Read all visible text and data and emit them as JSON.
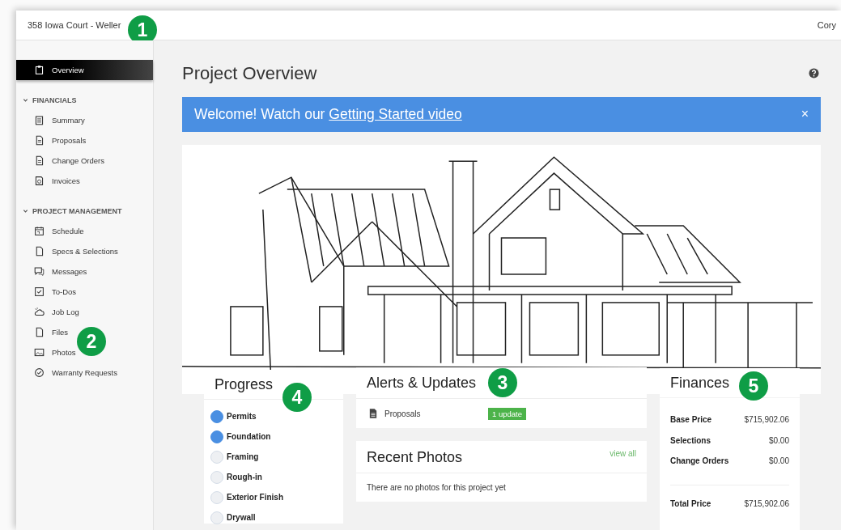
{
  "topbar": {
    "project": "358 Iowa Court - Weller",
    "user": "Cory"
  },
  "sidebar": {
    "items": [
      {
        "label": "Overview",
        "selected": true
      }
    ],
    "sections": [
      {
        "title": "FINANCIALS",
        "expanded": true,
        "items": [
          {
            "label": "Summary",
            "selected": false
          },
          {
            "label": "Proposals",
            "selected": false
          },
          {
            "label": "Change Orders",
            "selected": false
          },
          {
            "label": "Invoices",
            "selected": false
          }
        ]
      },
      {
        "title": "PROJECT MANAGEMENT",
        "expanded": true,
        "items": [
          {
            "label": "Schedule",
            "selected": false
          },
          {
            "label": "Specs & Selections",
            "selected": false
          },
          {
            "label": "Messages",
            "selected": false
          },
          {
            "label": "To-Dos",
            "selected": false
          },
          {
            "label": "Job Log",
            "selected": false
          },
          {
            "label": "Files",
            "selected": false
          },
          {
            "label": "Photos",
            "selected": false
          },
          {
            "label": "Warranty Requests",
            "selected": false
          }
        ]
      }
    ]
  },
  "page": {
    "title": "Project Overview"
  },
  "banner": {
    "text": "Welcome! Watch our",
    "link": "Getting Started video",
    "close": "×"
  },
  "progress": {
    "title": "Progress",
    "steps": [
      {
        "label": "Permits",
        "done": true
      },
      {
        "label": "Foundation",
        "done": true
      },
      {
        "label": "Framing",
        "done": false
      },
      {
        "label": "Rough-in",
        "done": false
      },
      {
        "label": "Exterior Finish",
        "done": false
      },
      {
        "label": "Drywall",
        "done": false
      }
    ]
  },
  "alerts": {
    "title": "Alerts & Updates",
    "items": [
      {
        "label": "Proposals",
        "badge": "1 update"
      }
    ]
  },
  "recent_photos": {
    "title": "Recent Photos",
    "link": "view all",
    "empty": "There are no photos for this project yet"
  },
  "finances": {
    "title": "Finances",
    "rows": [
      {
        "label": "Base Price",
        "value": "$715,902.06"
      },
      {
        "label": "Selections",
        "value": "$0.00"
      },
      {
        "label": "Change Orders",
        "value": "$0.00"
      }
    ],
    "total": {
      "label": "Total Price",
      "value": "$715,902.06"
    }
  },
  "callouts": [
    "1",
    "2",
    "3",
    "4",
    "5"
  ]
}
